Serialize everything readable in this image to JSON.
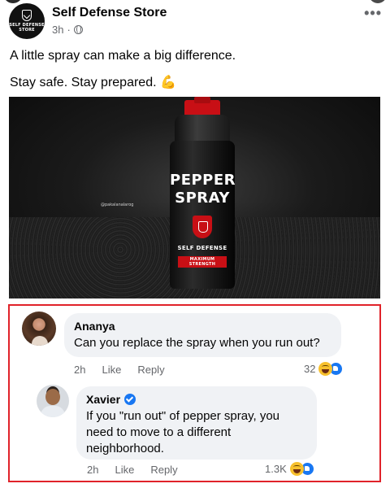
{
  "post": {
    "page_name": "Self Defense Store",
    "logo_text_1": "SELF DEFENSE",
    "logo_text_2": "STORE",
    "time": "3h",
    "separator": "·",
    "more": "•••",
    "caption_line1": "A little spray can make a big difference.",
    "caption_line2": "Stay safe. Stay prepared.",
    "caption_emoji": "💪",
    "image": {
      "watermark": "@pakalanalarog",
      "can_line1": "PEPPER",
      "can_line2": "SPRAY",
      "can_sub": "SELF DEFENSE",
      "can_strength": "MAXIMUM STRENGTH"
    }
  },
  "comments": [
    {
      "author": "Ananya",
      "text": "Can you replace the spray when you run out?",
      "time": "2h",
      "like_label": "Like",
      "reply_label": "Reply",
      "reaction_count": "32",
      "verified": false
    },
    {
      "author": "Xavier",
      "text": "If you \"run out\" of pepper spray, you need to move to a different neighborhood.",
      "time": "2h",
      "like_label": "Like",
      "reply_label": "Reply",
      "reaction_count": "1.3K",
      "verified": true
    }
  ],
  "colors": {
    "highlight_border": "#e0232a",
    "facebook_blue": "#1877f2",
    "brand_red": "#c80f15"
  },
  "icons": [
    "globe-icon",
    "more-options-icon",
    "verified-badge-icon",
    "haha-reaction-icon",
    "like-reaction-icon"
  ]
}
